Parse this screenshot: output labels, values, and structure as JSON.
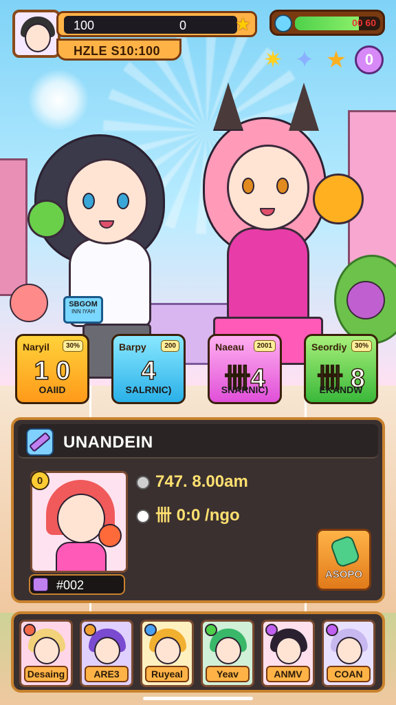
{
  "top_bar": {
    "left_value": "100",
    "right_value": "0",
    "sub_label": "HZLE S10:100",
    "star_icon": "star-icon"
  },
  "energy": {
    "text": "00 60",
    "fill_fraction": 0.75,
    "color": "#4fd04a"
  },
  "quick_icons": {
    "items": [
      "sparkle-star-icon",
      "diamond-sparkle-icon",
      "gold-star-icon"
    ],
    "badge_value": "0"
  },
  "bubble": {
    "line1": "SBGOM",
    "line2": "INN IYAH"
  },
  "stat_cards": [
    {
      "name": "Naryil",
      "pct": "30%",
      "value": "1 0",
      "sub": "OAIID",
      "color": "#ffb020"
    },
    {
      "name": "Barpy",
      "pct": "200",
      "value": "4",
      "sub": "SALRNIC)",
      "color": "#3ec0f0"
    },
    {
      "name": "Naeau",
      "pct": "2001",
      "value": "卌4",
      "sub": "SNARNIC)",
      "color": "#e86ae6"
    },
    {
      "name": "Seordiy",
      "pct": "30%",
      "value": "卌 8",
      "sub": "EKANDW",
      "color": "#4fc84a"
    }
  ],
  "panel": {
    "title": "UNANDEIN",
    "level": "0",
    "card_id": "#002",
    "info_time": "747. 8.00am",
    "info_rate": "卌 0:0 /ngo",
    "action_label": "ASOPO"
  },
  "roster": [
    {
      "label": "Desaing",
      "hair": "#f2d27a",
      "elem": "#f06a4a"
    },
    {
      "label": "ARE3",
      "hair": "#7a4ad0",
      "elem": "#f0a030"
    },
    {
      "label": "Ruyeal",
      "hair": "#f2b030",
      "elem": "#4aa0f0"
    },
    {
      "label": "Yeav",
      "hair": "#3ab86a",
      "elem": "#4fd04a"
    },
    {
      "label": "ANMV",
      "hair": "#2a2030",
      "elem": "#c060f0"
    },
    {
      "label": "COAN",
      "hair": "#c8b8f0",
      "elem": "#c060f0"
    }
  ]
}
